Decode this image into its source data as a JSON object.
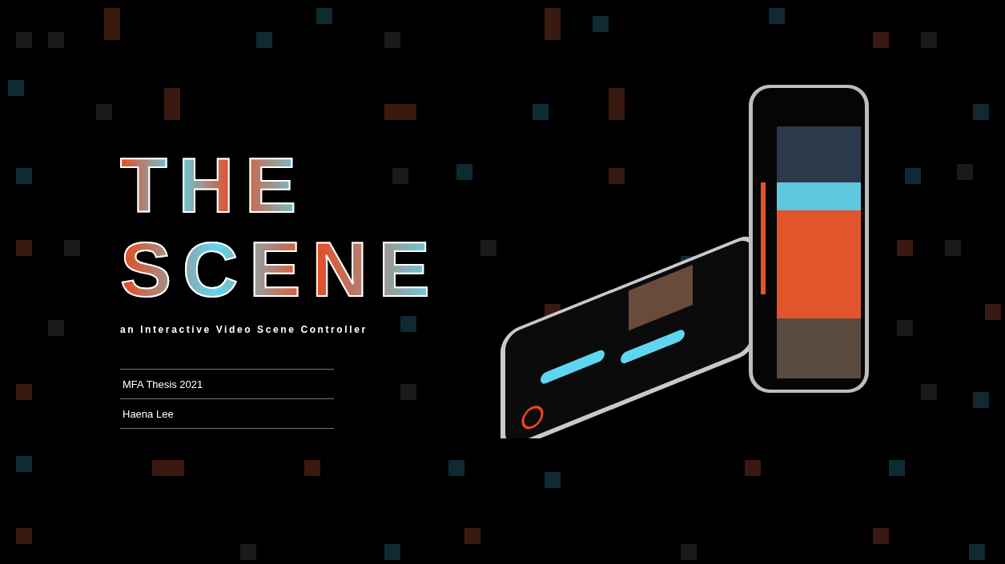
{
  "logo": {
    "lines": [
      "THE",
      "SCENE"
    ]
  },
  "subtitle": "an Interactive Video Scene Controller",
  "credits": [
    "MFA Thesis 2021",
    "Haena Lee"
  ]
}
